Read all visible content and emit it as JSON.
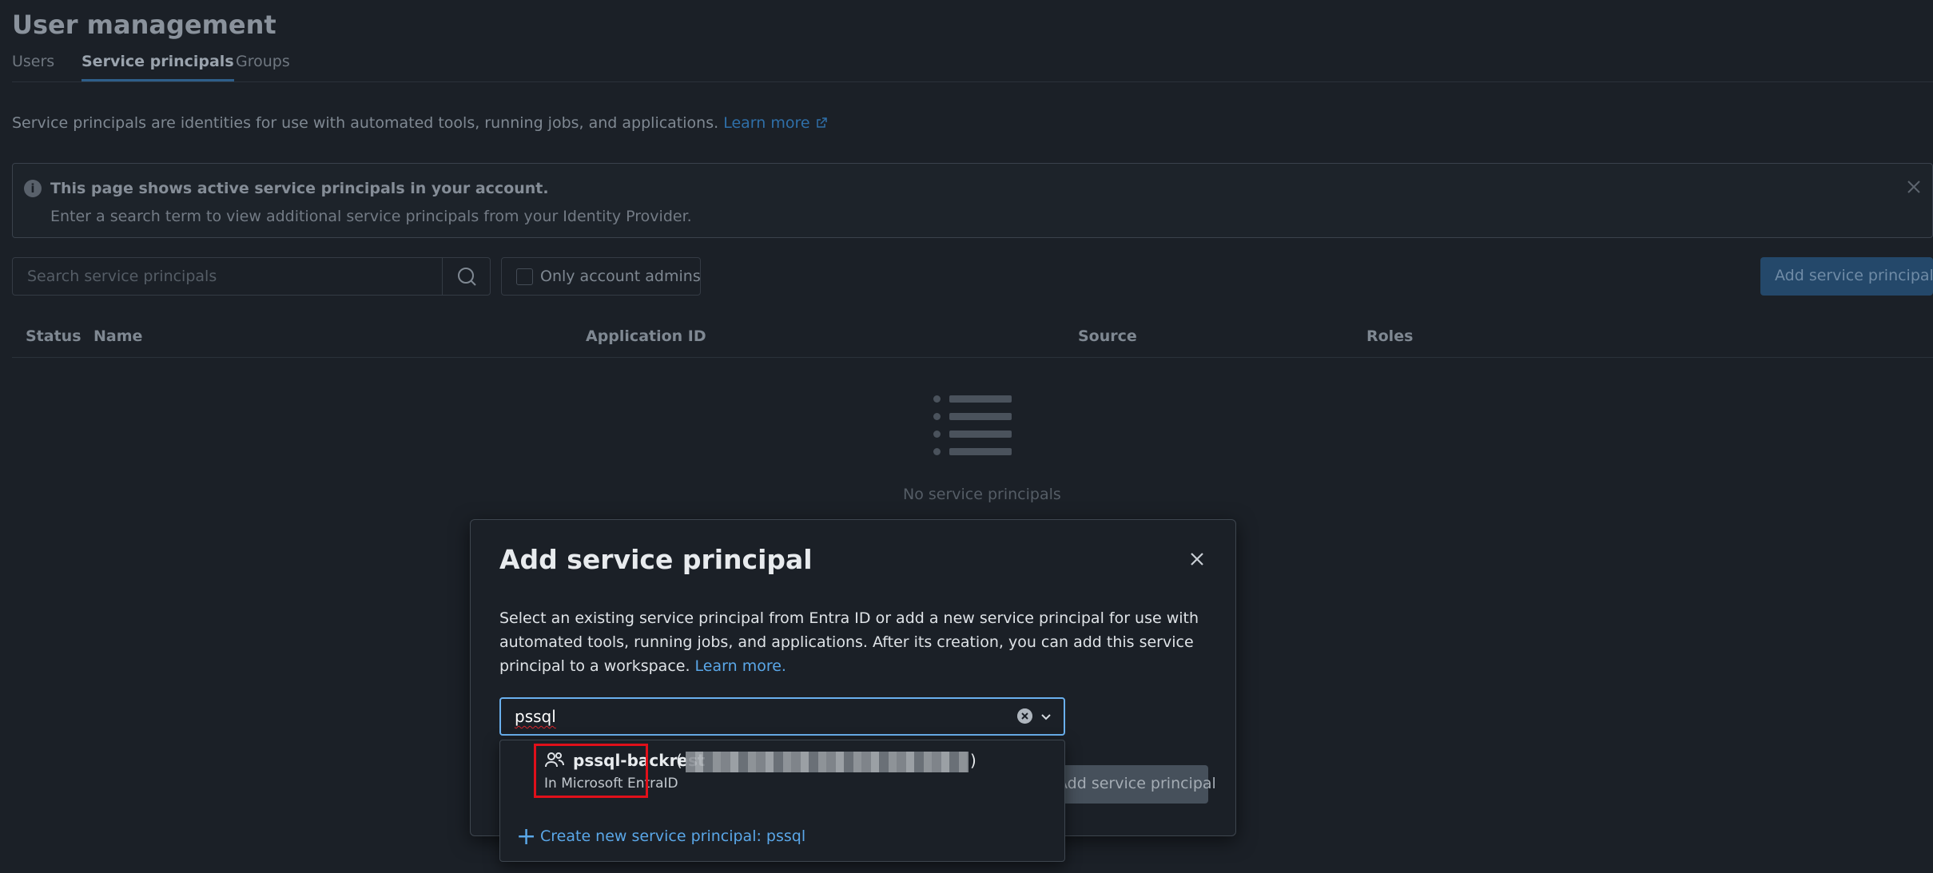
{
  "page": {
    "title": "User management",
    "tabs": [
      {
        "label": "Users",
        "active": false
      },
      {
        "label": "Service principals",
        "active": true
      },
      {
        "label": "Groups",
        "active": false
      }
    ],
    "intro_text": "Service principals are identities for use with automated tools, running jobs, and applications.",
    "intro_link": "Learn more",
    "notice": {
      "title": "This page shows active service principals in your account.",
      "body": "Enter a search term to view additional service principals from your Identity Provider.",
      "icon": "info-icon"
    },
    "search": {
      "placeholder": "Search service principals"
    },
    "filter": {
      "label": "Only account admins",
      "checked": false
    },
    "add_button": "Add service principal",
    "table": {
      "columns": [
        "Status",
        "Name",
        "Application ID",
        "Source",
        "Roles"
      ],
      "rows": []
    },
    "empty_state": "No service principals"
  },
  "modal": {
    "title": "Add service principal",
    "description": "Select an existing service principal from Entra ID or add a new service principal for use with automated tools, running jobs, and applications. After its creation, you can add this service principal to a workspace.",
    "description_link": "Learn more.",
    "combobox": {
      "value": "pssql"
    },
    "primary_button": "Add service principal",
    "dropdown": {
      "options": [
        {
          "name": "pssql-backrest",
          "source": "In Microsoft EntraID",
          "icon": "service-principal-icon",
          "highlighted": true
        }
      ],
      "create_label": "Create new service principal: pssql"
    }
  },
  "colors": {
    "accent": "#5aa7e8",
    "focus_border": "#6ab0ee",
    "highlight_box": "#e0101a",
    "background": "#1b2027"
  }
}
